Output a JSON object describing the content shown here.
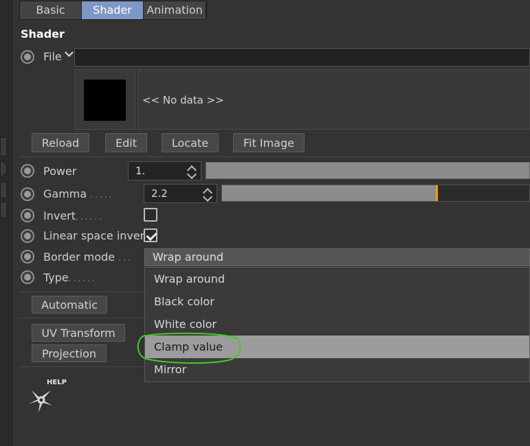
{
  "tabs": [
    {
      "label": "Basic",
      "active": false
    },
    {
      "label": "Shader",
      "active": true
    },
    {
      "label": "Animation",
      "active": false
    }
  ],
  "section_title": "Shader",
  "file": {
    "label": "File",
    "value": ""
  },
  "preview": {
    "no_data_text": "<< No data >>"
  },
  "buttons": {
    "reload": "Reload",
    "edit": "Edit",
    "locate": "Locate",
    "fit_image": "Fit Image"
  },
  "params": {
    "power": {
      "label": "Power",
      "value": "1."
    },
    "gamma": {
      "label": "Gamma",
      "value": "2.2",
      "slider_fraction": 0.7
    },
    "invert": {
      "label": "Invert",
      "checked": false
    },
    "linear_space_invert": {
      "label": "Linear space invert",
      "checked": true
    },
    "border_mode": {
      "label": "Border mode",
      "value": "Wrap around"
    },
    "type": {
      "label": "Type"
    }
  },
  "border_mode_options": [
    "Wrap around",
    "Black color",
    "White color",
    "Clamp value",
    "Mirror"
  ],
  "highlighted_option": "Clamp value",
  "lower_buttons": {
    "automatic": "Automatic",
    "uv_transform": "UV Transform",
    "projection": "Projection"
  },
  "help_label": "HELP",
  "colors": {
    "accent": "#7d98c4",
    "annotation": "#3ecf1e",
    "gamma_marker": "#f0a000"
  }
}
